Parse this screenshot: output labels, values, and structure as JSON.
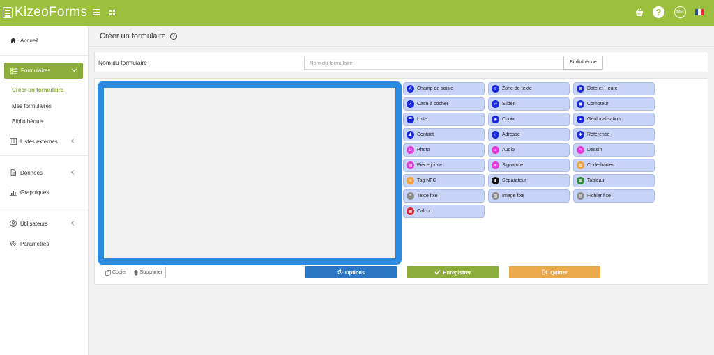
{
  "app": {
    "brand": "KizeoForms",
    "avatar_initials": "MR"
  },
  "colors": {
    "topbar": "#9bc03e",
    "sidebar_active": "#8aad3b",
    "canvas_border": "#2a8be0",
    "component_bg": "#c7d3f7",
    "options_button": "#2c78c4",
    "save_button": "#8aad3b",
    "quit_button": "#e9a84a"
  },
  "sidebar": {
    "home": "Accueil",
    "forms": "Formulaires",
    "forms_sub": [
      "Créer un formulaire",
      "Mes formulaires",
      "Bibliothèque"
    ],
    "external_lists": "Listes externes",
    "data": "Données",
    "charts": "Graphiques",
    "users": "Utilisateurs",
    "settings": "Paramètres"
  },
  "page": {
    "title": "Créer un formulaire",
    "help_icon": "?",
    "name_label": "Nom du formulaire",
    "name_value": "",
    "name_placeholder": "Nom du formulaire",
    "library_button": "Bibliothèque"
  },
  "components": [
    {
      "label": "Champ de saisie",
      "icon": "text-input-icon",
      "color": "#1b2ad8"
    },
    {
      "label": "Zone de texte",
      "icon": "textarea-icon",
      "color": "#1b2ad8"
    },
    {
      "label": "Date et Heure",
      "icon": "calendar-icon",
      "color": "#1b2ad8"
    },
    {
      "label": "Case à cocher",
      "icon": "checkbox-icon",
      "color": "#1b2ad8"
    },
    {
      "label": "Slider",
      "icon": "slider-icon",
      "color": "#1b2ad8"
    },
    {
      "label": "Compteur",
      "icon": "counter-icon",
      "color": "#1b2ad8"
    },
    {
      "label": "Liste",
      "icon": "list-icon",
      "color": "#1b2ad8"
    },
    {
      "label": "Choix",
      "icon": "choice-icon",
      "color": "#1b2ad8"
    },
    {
      "label": "Géolocalisation",
      "icon": "globe-icon",
      "color": "#1b2ad8"
    },
    {
      "label": "Contact",
      "icon": "contact-icon",
      "color": "#1b2ad8"
    },
    {
      "label": "Adresse",
      "icon": "home-icon",
      "color": "#1b2ad8"
    },
    {
      "label": "Référence",
      "icon": "asterisk-icon",
      "color": "#1b2ad8"
    },
    {
      "label": "Photo",
      "icon": "camera-icon",
      "color": "#e339d8"
    },
    {
      "label": "Audio",
      "icon": "microphone-icon",
      "color": "#e339d8"
    },
    {
      "label": "Dessin",
      "icon": "pencil-icon",
      "color": "#e339d8"
    },
    {
      "label": "Pièce jointe",
      "icon": "attachment-icon",
      "color": "#e339d8"
    },
    {
      "label": "Signature",
      "icon": "signature-icon",
      "color": "#e339d8"
    },
    {
      "label": "Code-barres",
      "icon": "barcode-icon",
      "color": "#f3a23a"
    },
    {
      "label": "Tag NFC",
      "icon": "nfc-icon",
      "color": "#f3a23a"
    },
    {
      "label": "Séparateur",
      "icon": "bookmark-icon",
      "color": "#111111"
    },
    {
      "label": "Tableau",
      "icon": "table-icon",
      "color": "#2e8b3a"
    },
    {
      "label": "Texte fixe",
      "icon": "fixed-text-icon",
      "color": "#8a8a8a"
    },
    {
      "label": "Image fixe",
      "icon": "fixed-image-icon",
      "color": "#8a8a8a"
    },
    {
      "label": "Fichier fixe",
      "icon": "fixed-file-icon",
      "color": "#8a8a8a"
    },
    {
      "label": "Calcul",
      "icon": "calculator-icon",
      "color": "#e0262d"
    }
  ],
  "actions": {
    "copy": "Copier",
    "delete": "Supprimer",
    "options": "Options",
    "save": "Enregistrer",
    "quit": "Quitter"
  }
}
